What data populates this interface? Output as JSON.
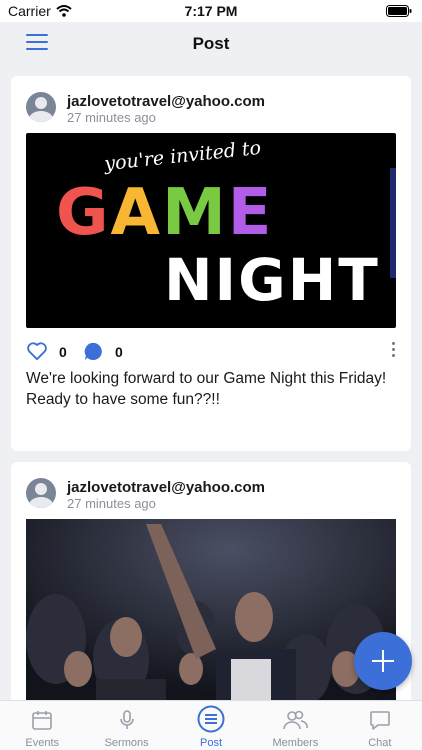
{
  "status_bar": {
    "carrier": "Carrier",
    "time": "7:17 PM"
  },
  "header": {
    "title": "Post"
  },
  "posts": [
    {
      "author": "jazlovetotravel@yahoo.com",
      "time_ago": "27 minutes ago",
      "image_text": {
        "line1": "you're invited to",
        "line2": "GAME",
        "line3": "NIGHT"
      },
      "likes": "0",
      "comments": "0",
      "caption": "We're looking forward to our Game Night this Friday!  Ready to have some fun??!!"
    },
    {
      "author": "jazlovetotravel@yahoo.com",
      "time_ago": "27 minutes ago"
    }
  ],
  "tabs": [
    {
      "label": "Events",
      "icon": "calendar-icon"
    },
    {
      "label": "Sermons",
      "icon": "microphone-icon"
    },
    {
      "label": "Post",
      "icon": "post-list-icon",
      "active": true
    },
    {
      "label": "Members",
      "icon": "members-icon"
    },
    {
      "label": "Chat",
      "icon": "chat-icon"
    }
  ],
  "colors": {
    "accent": "#3d6fd8",
    "background": "#eef0f4",
    "card": "#ffffff",
    "muted": "#8a8f99"
  }
}
